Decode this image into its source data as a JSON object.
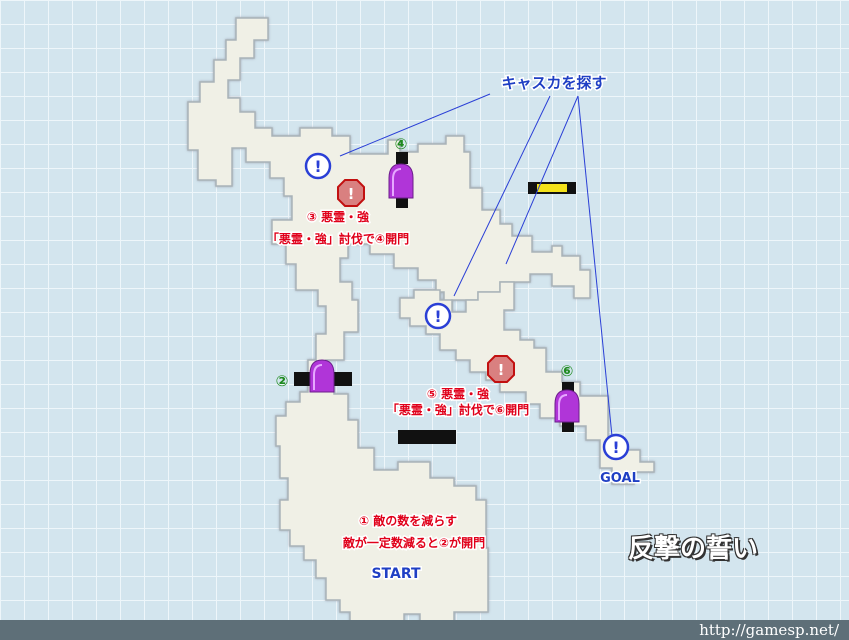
{
  "map": {
    "title": "反撃の誓い",
    "credit": "http://gamesp.net/",
    "callout": "キャスカを探す",
    "start_label": "START",
    "goal_label": "GOAL",
    "step1_line1": "① 敵の数を減らす",
    "step1_line2": "敵が一定数減ると②が開門",
    "step3_line1": "③ 悪霊・強",
    "step3_line2": "「悪霊・強」討伐で④開門",
    "step5_line1": "⑤ 悪霊・強",
    "step5_line2": "「悪霊・強」討伐で⑥開門",
    "gate2": "②",
    "gate4": "④",
    "gate6": "⑥",
    "info_mark": "!",
    "alert_mark": "!"
  },
  "colors": {
    "floor": "#f0f0e6",
    "outline": "#ffffff",
    "gate": "#b035d8",
    "info": "#2a3fd6",
    "alert": "#d42a2a",
    "label_red": "#e0001a",
    "label_green": "#1f8a1f",
    "label_blue": "#1f3fc4",
    "yellow_item": "#f3e21a"
  }
}
